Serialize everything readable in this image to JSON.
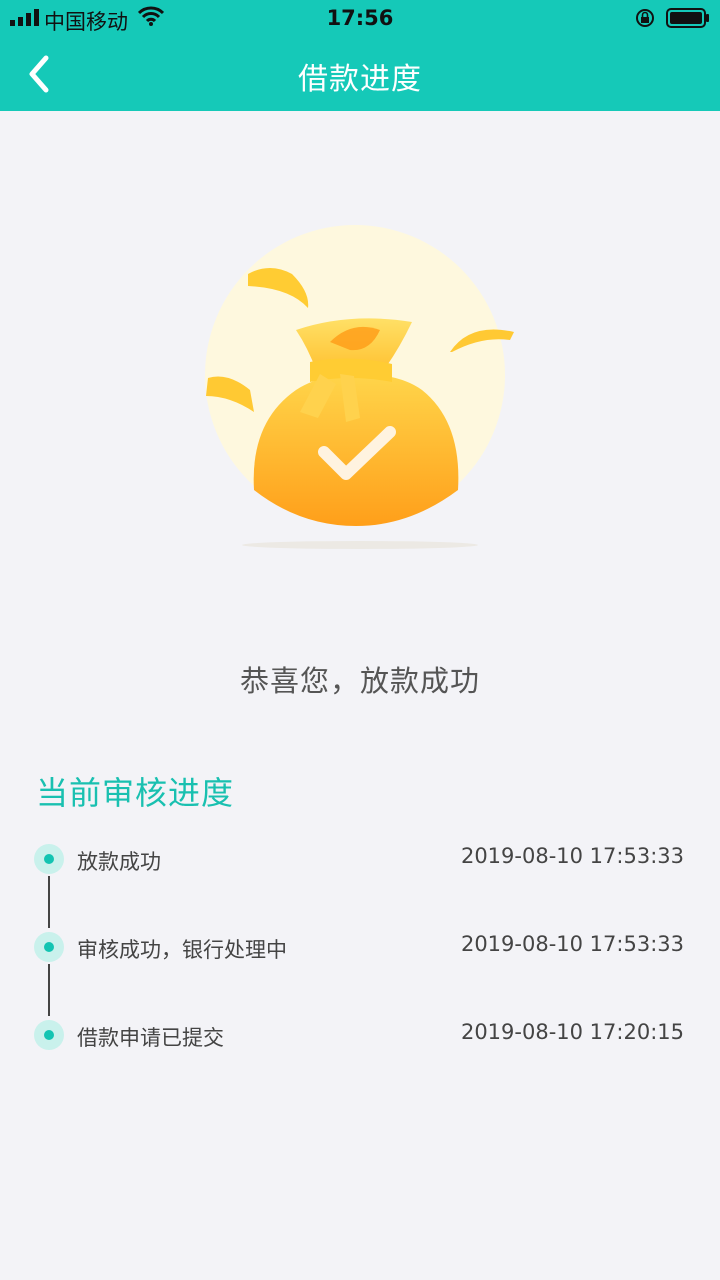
{
  "status_bar": {
    "carrier": "中国移动",
    "time": "17:56"
  },
  "nav": {
    "title": "借款进度",
    "back_icon": "chevron-left-icon"
  },
  "illustration": {
    "icon": "money-bag-check-icon",
    "colors": {
      "bag": "#ffa726",
      "circle": "#fff8dc",
      "check": "#fff3e0"
    }
  },
  "message": "恭喜您，放款成功",
  "progress": {
    "title": "当前审核进度",
    "steps": [
      {
        "label": "放款成功",
        "time": "2019-08-10 17:53:33"
      },
      {
        "label": "审核成功，银行处理中",
        "time": "2019-08-10 17:53:33"
      },
      {
        "label": "借款申请已提交",
        "time": "2019-08-10 17:20:15"
      }
    ]
  },
  "colors": {
    "accent": "#15c9b8",
    "background": "#f3f3f7"
  }
}
